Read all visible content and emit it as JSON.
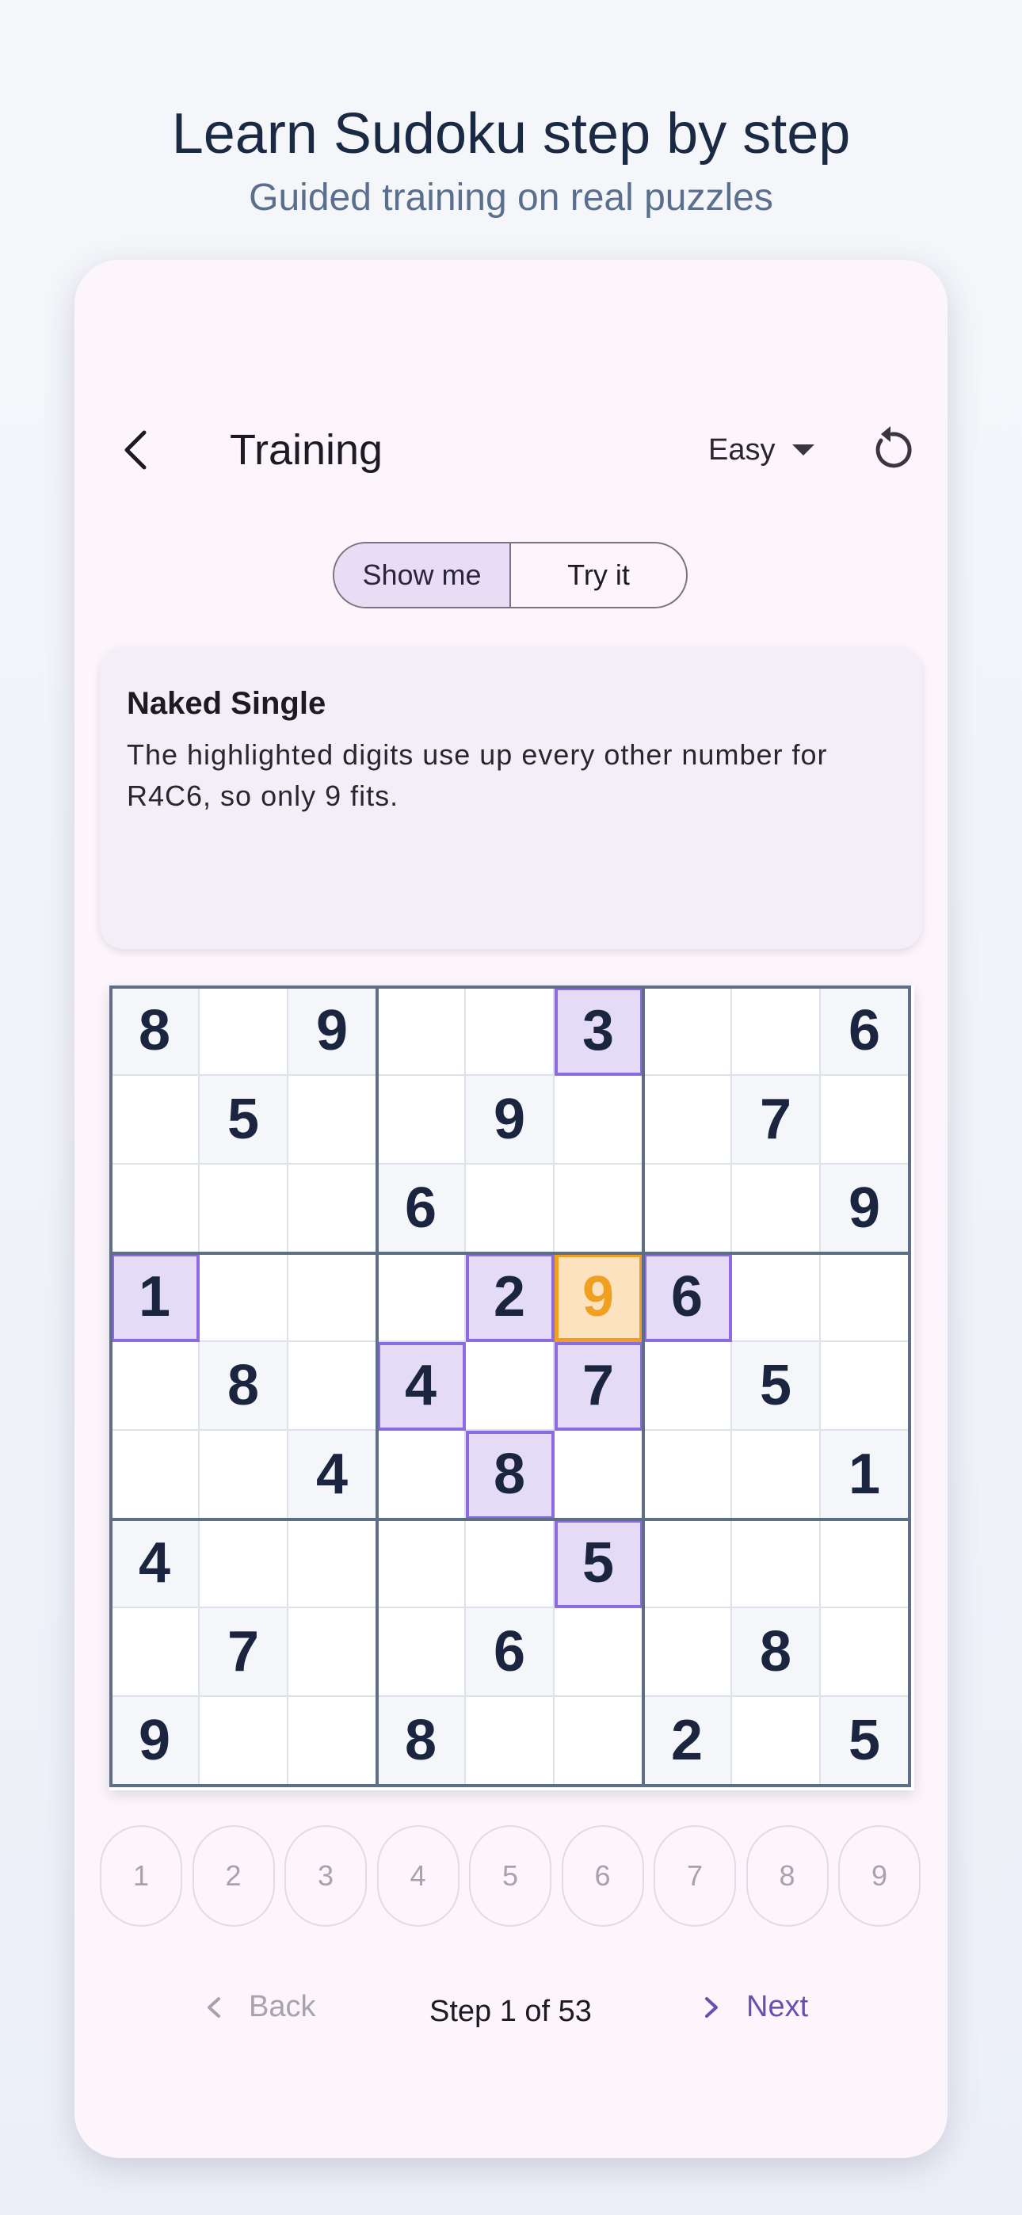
{
  "headline": {
    "title": "Learn Sudoku step by step",
    "subtitle": "Guided training on real puzzles"
  },
  "app": {
    "title": "Training",
    "difficulty": "Easy",
    "icons": {
      "back": "arrow-back-icon",
      "difficulty": "caret-down-icon",
      "restart": "refresh-icon"
    }
  },
  "mode": {
    "show_me": "Show me",
    "try_it": "Try it",
    "selected": "Show me"
  },
  "hint": {
    "title": "Naked Single",
    "text": "The highlighted digits use up every other number for R4C6, so only 9 fits."
  },
  "colors": {
    "accent": "#8c6ae0",
    "target": "#f0a020",
    "highlight_bg": "#e4dcf6",
    "target_bg": "#fde2c0"
  },
  "board": {
    "rows": [
      [
        "8",
        "",
        "9",
        "",
        "",
        "3",
        "",
        "",
        "6"
      ],
      [
        "",
        "5",
        "",
        "",
        "9",
        "",
        "",
        "7",
        ""
      ],
      [
        "",
        "",
        "",
        "6",
        "",
        "",
        "",
        "",
        "9"
      ],
      [
        "1",
        "",
        "",
        "",
        "2",
        "9",
        "6",
        "",
        ""
      ],
      [
        "",
        "8",
        "",
        "4",
        "",
        "7",
        "",
        "5",
        ""
      ],
      [
        "",
        "",
        "4",
        "",
        "8",
        "",
        "",
        "",
        "1"
      ],
      [
        "4",
        "",
        "",
        "",
        "",
        "5",
        "",
        "",
        ""
      ],
      [
        "",
        "7",
        "",
        "",
        "6",
        "",
        "",
        "8",
        ""
      ],
      [
        "9",
        "",
        "",
        "8",
        "",
        "",
        "2",
        "",
        "5"
      ]
    ],
    "highlighted": [
      [
        0,
        5
      ],
      [
        3,
        0
      ],
      [
        3,
        4
      ],
      [
        3,
        6
      ],
      [
        4,
        3
      ],
      [
        4,
        5
      ],
      [
        5,
        4
      ],
      [
        6,
        5
      ]
    ],
    "target": [
      3,
      5
    ]
  },
  "number_pad": [
    "1",
    "2",
    "3",
    "4",
    "5",
    "6",
    "7",
    "8",
    "9"
  ],
  "stepbar": {
    "back": "Back",
    "step": "Step 1 of 53",
    "next": "Next"
  }
}
